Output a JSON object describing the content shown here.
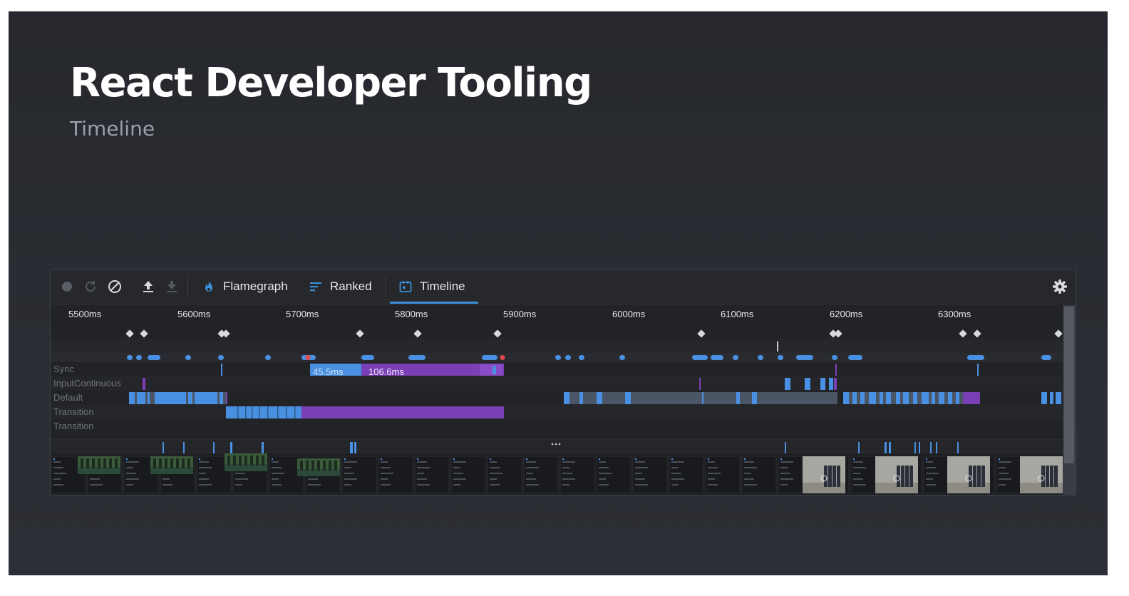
{
  "slide": {
    "title": "React Developer Tooling",
    "subtitle": "Timeline"
  },
  "toolbar": {
    "buttons": [
      {
        "name": "record-button",
        "icon": "record-icon"
      },
      {
        "name": "reload-and-profile-button",
        "icon": "reload-icon"
      },
      {
        "name": "clear-button",
        "icon": "clear-icon"
      },
      {
        "name": "load-profile-button",
        "icon": "upload-icon"
      },
      {
        "name": "save-profile-button",
        "icon": "download-icon"
      }
    ],
    "tabs": [
      {
        "label": "Flamegraph",
        "icon": "flame-icon"
      },
      {
        "label": "Ranked",
        "icon": "ranked-icon"
      },
      {
        "label": "Timeline",
        "icon": "calendar-icon",
        "selected": true
      }
    ],
    "settings_icon": "gear-icon"
  },
  "ruler": {
    "ticks": [
      "5500ms",
      "5600ms",
      "5700ms",
      "5800ms",
      "5900ms",
      "6000ms",
      "6100ms",
      "6200ms",
      "6300ms"
    ]
  },
  "lanes": [
    "Sync",
    "InputContinuous",
    "Default",
    "Transition",
    "Transition"
  ],
  "measures": {
    "first": "45.5ms",
    "second": "106.6ms"
  },
  "colors": {
    "accent": "#3a8fd8",
    "render_blue": "#4a90e2",
    "commit_purple": "#7b3fb5",
    "muted_blue": "#4a5666",
    "error_red": "#e5484d"
  }
}
